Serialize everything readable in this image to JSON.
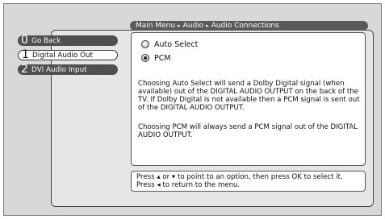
{
  "breadcrumb": {
    "items": [
      "Main Menu",
      "Audio",
      "Audio Connections"
    ],
    "separator": "▸"
  },
  "menu": {
    "items": [
      {
        "number": "0",
        "label": "Go Back"
      },
      {
        "number": "1",
        "label": "Digital Audio Out"
      },
      {
        "number": "2",
        "label": "DVI Audio Input"
      }
    ]
  },
  "options": {
    "items": [
      {
        "label": "Auto Select",
        "selected": false
      },
      {
        "label": "PCM",
        "selected": true
      }
    ]
  },
  "description": {
    "paragraph1": "Choosing Auto Select will send a Dolby Digital signal (when available) out of the DIGITAL AUDIO OUTPUT on the back of the TV. If Dolby Digital is not available then a PCM signal is sent out of the DIGITAL AUDIO OUTPUT.",
    "paragraph2": "Choosing PCM will always send a PCM signal out of the DIGITAL AUDIO OUTPUT."
  },
  "hint": {
    "text": "Press ▴ or ▾ to point to an option, then press OK to select it. Press ◂ to return to the menu."
  },
  "colors": {
    "menu_bar": "#4f4f4f",
    "panel_bg": "#e6e6e6",
    "screen_bg": "#d8d8d8"
  }
}
